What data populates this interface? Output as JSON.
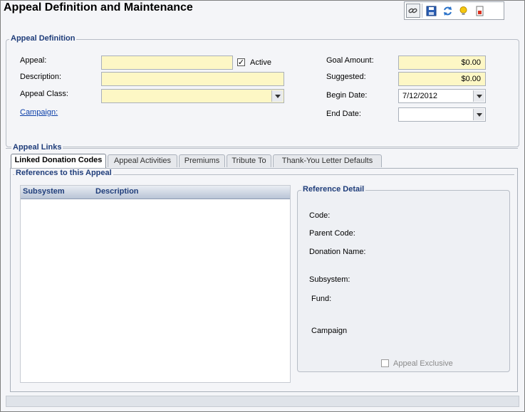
{
  "title": "Appeal Definition and Maintenance",
  "toolbar": {
    "icons": [
      "link-icon",
      "save-icon",
      "refresh-icon",
      "lightbulb-icon",
      "report-icon"
    ]
  },
  "appeal_definition": {
    "group_label": "Appeal Definition",
    "appeal_label": "Appeal:",
    "appeal_value": "",
    "active_label": "Active",
    "active_checked": true,
    "description_label": "Description:",
    "description_value": "",
    "appeal_class_label": "Appeal Class:",
    "appeal_class_value": "",
    "campaign_label": "Campaign:",
    "goal_amount_label": "Goal Amount:",
    "goal_amount_value": "$0.00",
    "suggested_label": "Suggested:",
    "suggested_value": "$0.00",
    "begin_date_label": "Begin Date:",
    "begin_date_value": "7/12/2012",
    "end_date_label": "End Date:",
    "end_date_value": ""
  },
  "appeal_links": {
    "group_label": "Appeal Links",
    "tabs": [
      {
        "label": "Linked Donation Codes",
        "active": true
      },
      {
        "label": "Appeal Activities",
        "active": false
      },
      {
        "label": "Premiums",
        "active": false
      },
      {
        "label": "Tribute To",
        "active": false
      },
      {
        "label": "Thank-You Letter Defaults",
        "active": false
      }
    ],
    "references_label": "References to this Appeal",
    "grid_columns": [
      "Subsystem",
      "Description"
    ],
    "grid_rows": []
  },
  "reference_detail": {
    "group_label": "Reference Detail",
    "code_label": "Code:",
    "parent_code_label": "Parent Code:",
    "donation_name_label": "Donation Name:",
    "subsystem_label": "Subsystem:",
    "fund_label": "Fund:",
    "campaign_label": "Campaign",
    "appeal_exclusive_label": "Appeal Exclusive",
    "appeal_exclusive_checked": false
  }
}
